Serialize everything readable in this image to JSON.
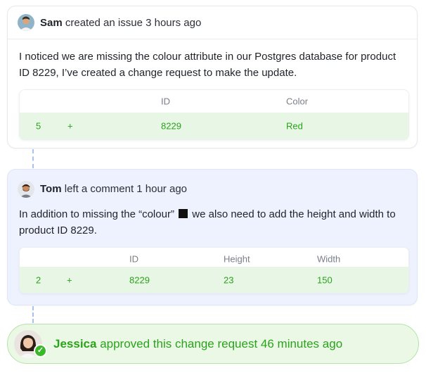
{
  "issue": {
    "author": "Sam",
    "action": "created an issue 3 hours ago",
    "body": "I noticed we are missing the colour attribute in our Postgres database for product ID 8229, I’ve created a change request to make the update.",
    "table": {
      "headers": [
        "",
        "",
        "ID",
        "Color"
      ],
      "row": [
        "5",
        "+",
        "8229",
        "Red"
      ]
    }
  },
  "comment": {
    "author": "Tom",
    "action": "left a comment 1 hour ago",
    "body_before": "In addition to missing the “colour”",
    "body_after": "we also need to add the height and width to product ID 8229.",
    "table": {
      "headers": [
        "",
        "",
        "ID",
        "Height",
        "Width"
      ],
      "row": [
        "2",
        "+",
        "8229",
        "23",
        "150"
      ]
    }
  },
  "approval": {
    "author": "Jessica",
    "action": "approved this change request 46 minutes ago"
  },
  "colors": {
    "accent_green": "#2aa31b",
    "row_green_bg": "#e8f6e5",
    "comment_bg": "#eef2ff",
    "connector": "#a9c0f0"
  },
  "icons": {
    "check": "check-icon",
    "swatch": "black-swatch"
  }
}
